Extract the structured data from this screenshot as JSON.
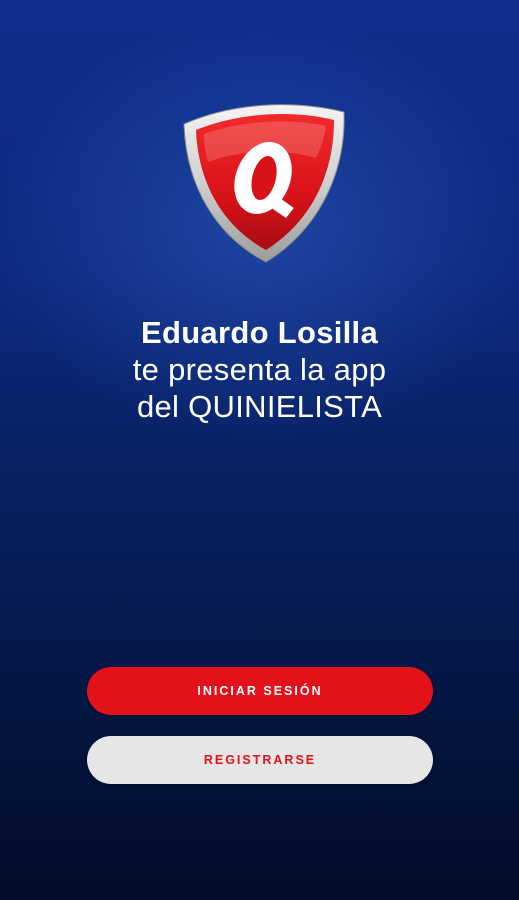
{
  "branding": {
    "logo_letter": "Q",
    "colors": {
      "shield_red": "#e3121a",
      "shield_silver": "#d9d9d9",
      "background_top": "#0f2f8e",
      "background_bottom": "#020c2a"
    }
  },
  "intro": {
    "line1": "Eduardo Losilla",
    "line2": "te presenta la app",
    "line3": "del QUINIELISTA"
  },
  "actions": {
    "login_label": "INICIAR SESIÓN",
    "register_label": "REGISTRARSE"
  }
}
